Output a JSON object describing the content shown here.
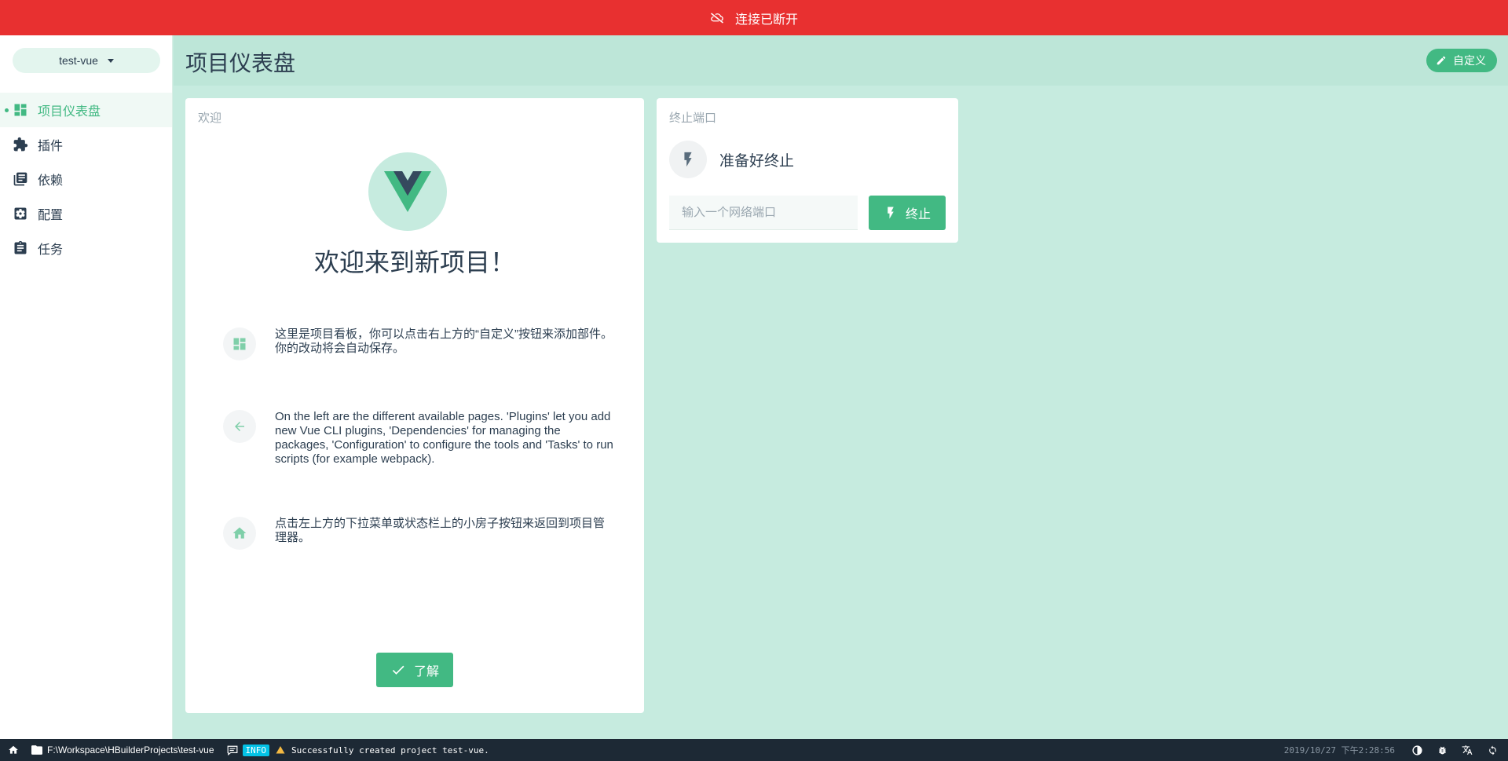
{
  "topbar": {
    "message": "连接已断开"
  },
  "sidebar": {
    "project_selector": "test-vue",
    "items": [
      {
        "label": "项目仪表盘",
        "icon": "dashboard-icon",
        "active": true
      },
      {
        "label": "插件",
        "icon": "puzzle-icon"
      },
      {
        "label": "依赖",
        "icon": "library-books-icon"
      },
      {
        "label": "配置",
        "icon": "settings-applications-icon"
      },
      {
        "label": "任务",
        "icon": "assignment-icon"
      }
    ]
  },
  "header": {
    "title": "项目仪表盘",
    "customize_label": "自定义"
  },
  "welcome": {
    "card_title": "欢迎",
    "heading": "欢迎来到新项目！",
    "tips": [
      {
        "icon": "dashboard-icon",
        "text": "这里是项目看板，你可以点击右上方的“自定义”按钮来添加部件。你的改动将会自动保存。"
      },
      {
        "icon": "arrow-back-icon",
        "text": "On the left are the different available pages. 'Plugins' let you add new Vue CLI plugins, 'Dependencies' for managing the packages, 'Configuration' to configure the tools and 'Tasks' to run scripts (for example webpack)."
      },
      {
        "icon": "home-icon",
        "text": "点击左上方的下拉菜单或状态栏上的小房子按钮来返回到项目管理器。"
      }
    ],
    "ok_label": "了解"
  },
  "kill_port": {
    "card_title": "终止端口",
    "status": "准备好终止",
    "input_placeholder": "输入一个网络端口",
    "input_value": "",
    "button_label": "终止"
  },
  "statusbar": {
    "path": "F:\\Workspace\\HBuilderProjects\\test-vue",
    "log_level": "INFO",
    "log_message": "Successfully created project test-vue.",
    "datetime": "2019/10/27 下午2:28:56"
  },
  "colors": {
    "accent": "#42b983",
    "error_bar": "#e83030",
    "page_bg": "#c6ebdf",
    "statusbar_bg": "#1d2935",
    "info_badge": "#03c2e6"
  }
}
